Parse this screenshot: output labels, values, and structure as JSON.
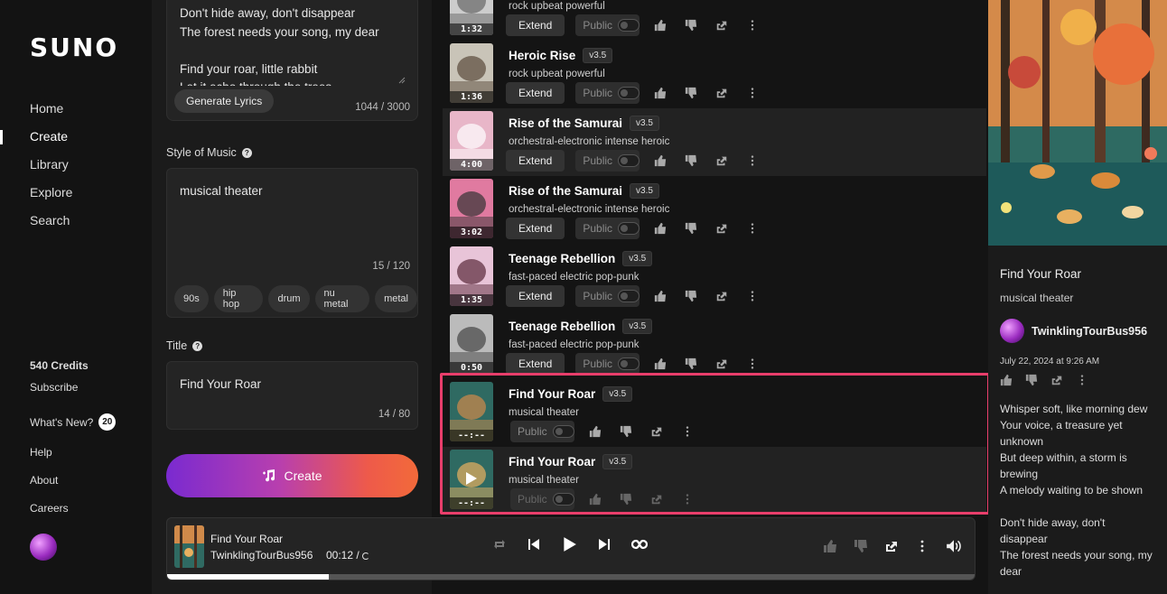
{
  "app": {
    "logo": "SUNO"
  },
  "nav": {
    "items": [
      "Home",
      "Create",
      "Library",
      "Explore",
      "Search"
    ],
    "credits": "540 Credits",
    "subscribe": "Subscribe",
    "whats_new": "What's New?",
    "whats_new_count": "20",
    "help": "Help",
    "about": "About",
    "careers": "Careers"
  },
  "create": {
    "lyrics_text": "Don't hide away, don't disappear\nThe forest needs your song, my dear\n\nFind your roar, little rabbit\nLet it echo through the trees",
    "generate_lyrics": "Generate Lyrics",
    "lyrics_count": "1044 / 3000",
    "style_label": "Style of Music",
    "style_value": "musical theater",
    "style_count": "15 / 120",
    "chips": [
      "90s",
      "hip hop",
      "drum",
      "nu metal",
      "metal"
    ],
    "title_label": "Title",
    "title_value": "Find Your Roar",
    "title_count": "14 / 80",
    "create_button": "Create"
  },
  "songs": [
    {
      "title": "",
      "version": "",
      "style": "rock upbeat powerful",
      "duration": "1:32",
      "extend": "Extend",
      "public": "Public"
    },
    {
      "title": "Heroic Rise",
      "version": "v3.5",
      "style": "rock upbeat powerful",
      "duration": "1:36",
      "extend": "Extend",
      "public": "Public"
    },
    {
      "title": "Rise of the Samurai",
      "version": "v3.5",
      "style": "orchestral-electronic intense heroic",
      "duration": "4:00",
      "extend": "Extend",
      "public": "Public"
    },
    {
      "title": "Rise of the Samurai",
      "version": "v3.5",
      "style": "orchestral-electronic intense heroic",
      "duration": "3:02",
      "extend": "Extend",
      "public": "Public"
    },
    {
      "title": "Teenage Rebellion",
      "version": "v3.5",
      "style": "fast-paced electric pop-punk",
      "duration": "1:35",
      "extend": "Extend",
      "public": "Public"
    },
    {
      "title": "Teenage Rebellion",
      "version": "v3.5",
      "style": "fast-paced electric pop-punk",
      "duration": "0:50",
      "extend": "Extend",
      "public": "Public"
    },
    {
      "title": "Find Your Roar",
      "version": "v3.5",
      "style": "musical theater",
      "duration": "--:--",
      "extend": "",
      "public": "Public"
    },
    {
      "title": "Find Your Roar",
      "version": "v3.5",
      "style": "musical theater",
      "duration": "--:--",
      "extend": "",
      "public": "Public"
    }
  ],
  "detail": {
    "title": "Find Your Roar",
    "style": "musical theater",
    "user": "TwinklingTourBus956",
    "date": "July 22, 2024 at 9:26 AM",
    "lyrics": "Whisper soft, like morning dew\nYour voice, a treasure yet unknown\nBut deep within, a storm is brewing\nA melody waiting to be shown\n\nDon't hide away, don't disappear\nThe forest needs your song, my dear\n\nFind your roar, little rabbit"
  },
  "player": {
    "title": "Find Your Roar",
    "user": "TwinklingTourBus956",
    "time": "00:12 /",
    "progress": 0.2
  },
  "colors": {
    "accent": "#e83e6b",
    "create_from": "#7a2ad0",
    "create_to": "#f26a3a"
  }
}
